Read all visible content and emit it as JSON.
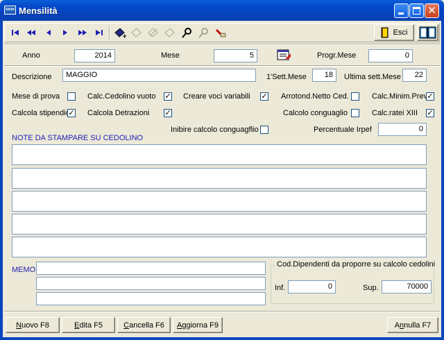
{
  "window": {
    "title": "Mensilità",
    "app_icon_text": "tmm"
  },
  "toolbar": {
    "exit_label": "Esci",
    "icons": [
      "first-record-icon",
      "prev-page-icon",
      "prev-record-icon",
      "next-record-icon",
      "next-page-icon",
      "last-record-icon",
      "add-record-icon",
      "edit-record-icon",
      "delete-record-icon",
      "save-record-icon",
      "search-icon",
      "clear-search-icon",
      "filter-icon",
      "exit-door-icon",
      "book-icon"
    ]
  },
  "header": {
    "anno_label": "Anno",
    "anno_value": "2014",
    "mese_label": "Mese",
    "mese_value": "5",
    "progr_label": "Progr.Mese",
    "progr_value": "0"
  },
  "description": {
    "label": "Descrizione",
    "value": "MAGGIO",
    "sett_label": "1'Sett.Mese",
    "sett_value": "18",
    "ultima_label": "Ultima sett.Mese",
    "ultima_value": "22"
  },
  "options": {
    "mese_prova": {
      "label": "Mese di prova",
      "checked": false
    },
    "cedolino_vuoto": {
      "label": "Calc.Cedolino vuoto",
      "checked": true
    },
    "voci_variabili": {
      "label": "Creare voci variabili",
      "checked": true
    },
    "arrotond": {
      "label": "Arrotond.Netto Ced.",
      "checked": false
    },
    "minim_prev": {
      "label": "Calc.Minim.Prev.",
      "checked": true
    },
    "stipendio": {
      "label": "Calcola stipendio",
      "checked": true
    },
    "detrazioni": {
      "label": "Calcola Detrazioni",
      "checked": true
    },
    "conguaglio": {
      "label": "Calcolo conguaglio",
      "checked": false
    },
    "ratei": {
      "label": "Calc.ratei XIII",
      "checked": true
    },
    "inibire": {
      "label": "Inibire calcolo conguagflio",
      "checked": false
    },
    "irpef_label": "Percentuale Irpef",
    "irpef_value": "0",
    "check_mark": "✓"
  },
  "notes": {
    "title": "NOTE DA STAMPARE SU CEDOLINO",
    "lines": [
      "",
      "",
      "",
      "",
      ""
    ]
  },
  "memo": {
    "label": "MEMO",
    "lines": [
      "",
      "",
      ""
    ]
  },
  "dipendenti": {
    "title": "Cod.Dipendenti da proporre su calcolo cedolini",
    "inf_label": "Inf.",
    "inf_value": "0",
    "sup_label": "Sup.",
    "sup_value": "70000"
  },
  "footer": {
    "nuovo": {
      "key": "N",
      "rest": "uovo F8"
    },
    "edita": {
      "key": "E",
      "rest": "dita F5"
    },
    "cancella": {
      "key": "C",
      "rest": "ancella F6"
    },
    "aggiorna": {
      "key": "A",
      "rest": "ggiorna F9"
    },
    "annulla": {
      "pre": "A",
      "key": "n",
      "rest": "nulla F7"
    }
  },
  "colors": {
    "title_bar": "#0548c9",
    "label_blue": "#1e1eb4",
    "face": "#ece9d8"
  }
}
